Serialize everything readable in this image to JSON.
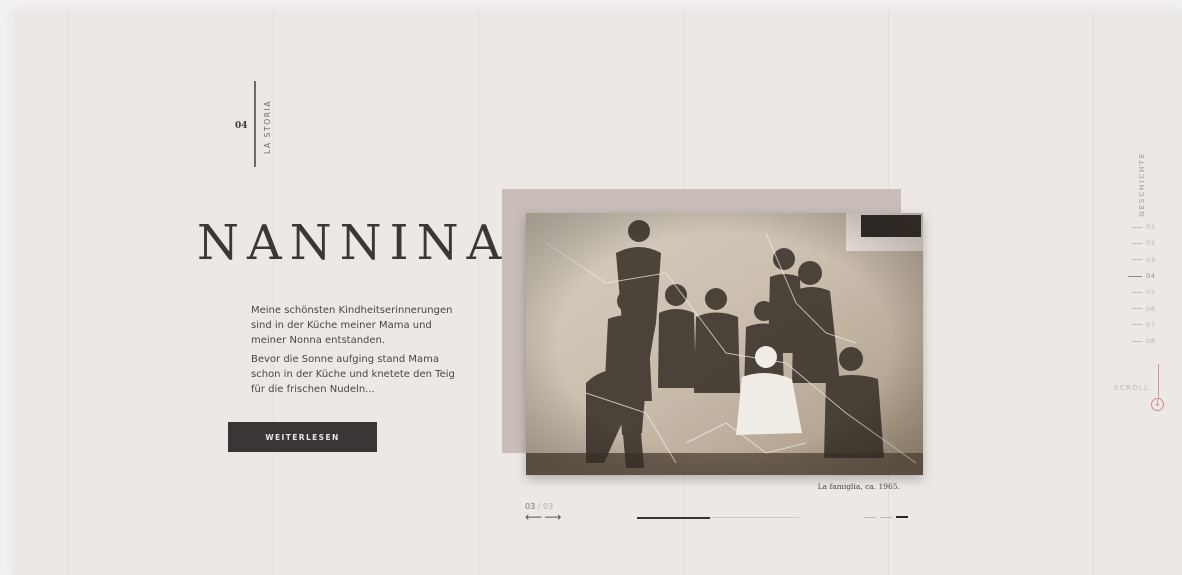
{
  "section": {
    "number": "04",
    "label": "LA STORIA"
  },
  "hero": {
    "title": "NANNINA",
    "paragraphs": [
      "Meine schönsten Kindheitserinnerungen sind in der Küche meiner Mama und meiner Nonna entstanden.",
      "Bevor die Sonne aufging stand Mama schon in der Küche und knetete den Teig für die frischen Nudeln..."
    ],
    "cta_label": "WEITERLESEN"
  },
  "photo": {
    "caption": "La famiglia, ca. 1965."
  },
  "slider": {
    "current": "03",
    "separator": "/",
    "total": "03",
    "prev_arrow": "⟵",
    "next_arrow": "⟶",
    "progress": 0.45,
    "dots": [
      {
        "active": false
      },
      {
        "active": false
      },
      {
        "active": true
      }
    ]
  },
  "side_nav": {
    "label": "GESCHICHTE",
    "items": [
      {
        "label": "01",
        "active": false
      },
      {
        "label": "02",
        "active": false
      },
      {
        "label": "03",
        "active": false
      },
      {
        "label": "04",
        "active": true
      },
      {
        "label": "05",
        "active": false
      },
      {
        "label": "06",
        "active": false
      },
      {
        "label": "07",
        "active": false
      },
      {
        "label": "08",
        "active": false
      }
    ]
  },
  "scroll": {
    "label": "SCROLL",
    "icon": "arrow-down-circle-icon"
  },
  "colors": {
    "page_bg": "#ece8e6",
    "text_dark": "#3a3737",
    "accent": "#d08b7e",
    "photo_frame": "#c8bdb9"
  }
}
